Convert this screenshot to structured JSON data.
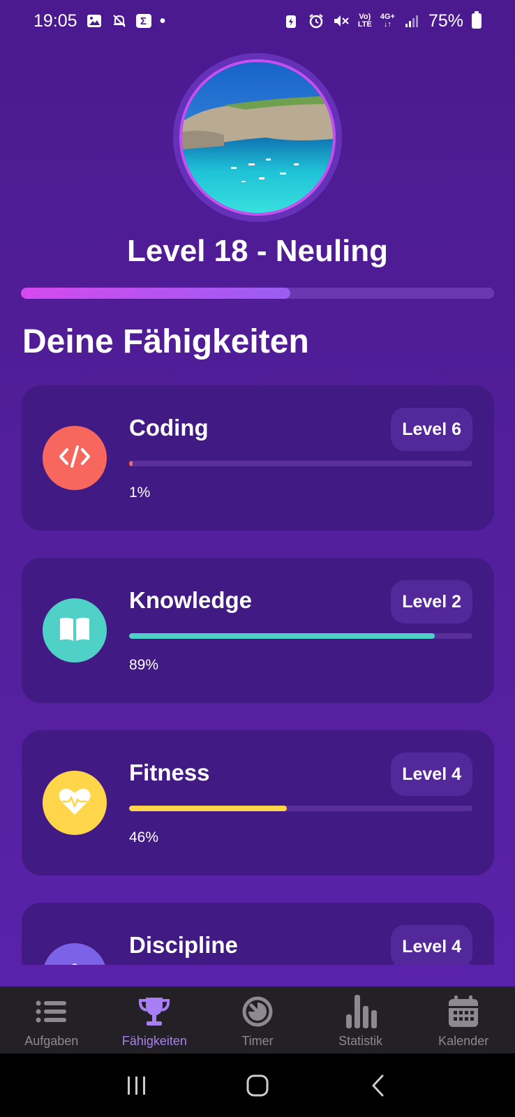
{
  "status_bar": {
    "time": "19:05",
    "sigma": "Σ",
    "dot": "•",
    "network_top": "Vo)",
    "network_bottom": "LTE",
    "four_g": "4G+",
    "battery": "75%"
  },
  "profile": {
    "level_title": "Level 18 - Neuling",
    "progress": 0.57
  },
  "section_title": "Deine Fähigkeiten",
  "skills": [
    {
      "name": "Coding",
      "level": "Level 6",
      "percent_label": "1%",
      "progress": 0.01,
      "color": "#f8675e",
      "icon": "code-icon"
    },
    {
      "name": "Knowledge",
      "level": "Level 2",
      "percent_label": "89%",
      "progress": 0.89,
      "color": "#4fd1c7",
      "icon": "book-icon"
    },
    {
      "name": "Fitness",
      "level": "Level 4",
      "percent_label": "46%",
      "progress": 0.46,
      "color": "#ffd54a",
      "icon": "heart-pulse-icon"
    },
    {
      "name": "Discipline",
      "level": "Level 4",
      "percent_label": "",
      "progress": 0,
      "color": "#7b63e8",
      "icon": "graduation-cap-icon"
    }
  ],
  "nav": [
    {
      "label": "Aufgaben",
      "icon": "list-icon",
      "active": false
    },
    {
      "label": "Fähigkeiten",
      "icon": "trophy-icon",
      "active": true
    },
    {
      "label": "Timer",
      "icon": "timer-icon",
      "active": false
    },
    {
      "label": "Statistik",
      "icon": "bar-chart-icon",
      "active": false
    },
    {
      "label": "Kalender",
      "icon": "calendar-icon",
      "active": false
    }
  ],
  "colors": {
    "background": "#4b1a8f",
    "card": "#421a83",
    "accent": "#a77ef3"
  }
}
